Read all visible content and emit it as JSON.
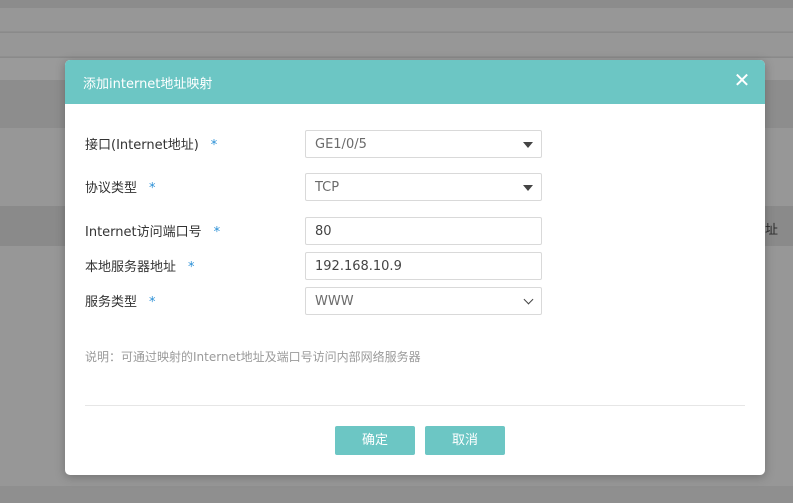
{
  "background": {
    "partial_text": "址"
  },
  "dialog": {
    "title": "添加internet地址映射",
    "close_glyph": "✕",
    "fields": {
      "interface": {
        "label": "接口(Internet地址)",
        "required": "*",
        "value": "GE1/0/5"
      },
      "protocol": {
        "label": "协议类型",
        "required": "*",
        "value": "TCP"
      },
      "internet_port": {
        "label": "Internet访问端口号",
        "required": "*",
        "value": "80"
      },
      "server_address": {
        "label": "本地服务器地址",
        "required": "*",
        "value": "192.168.10.9"
      },
      "service_type": {
        "label": "服务类型",
        "required": "*",
        "value": "WWW"
      }
    },
    "note": "说明：可通过映射的Internet地址及端口号访问内部网络服务器",
    "buttons": {
      "confirm": "确定",
      "cancel": "取消"
    }
  },
  "colors": {
    "accent": "#6cc6c4",
    "required_star": "#2a8fd6",
    "overlay": "#979797"
  }
}
